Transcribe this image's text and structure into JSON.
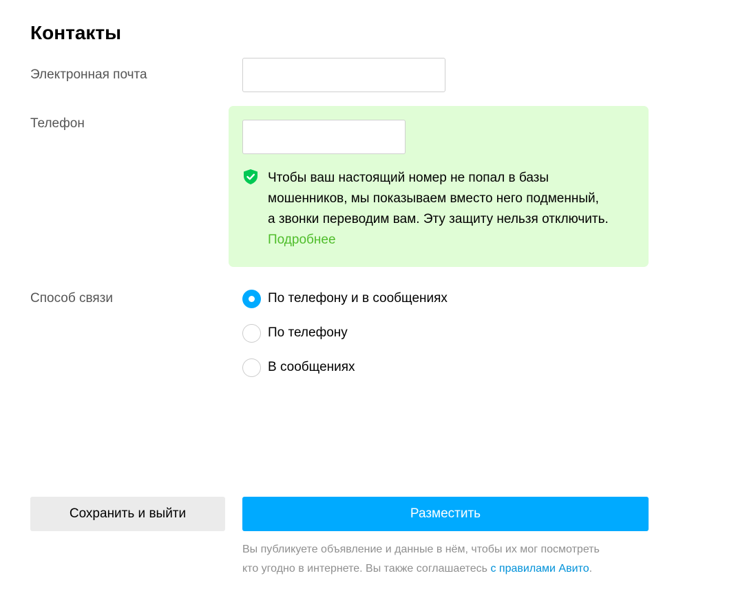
{
  "section": {
    "title": "Контакты"
  },
  "email": {
    "label": "Электронная почта",
    "value": ""
  },
  "phone": {
    "label": "Телефон",
    "value": "",
    "notice_line1": "Чтобы ваш настоящий номер не попал в базы",
    "notice_line2": "мошенников, мы показываем вместо него подменный,",
    "notice_line3": "а звонки переводим вам. Эту защиту нельзя отключить.",
    "notice_link": "Подробнее",
    "notice_icon": "shield-check-icon"
  },
  "contact_method": {
    "label": "Способ связи",
    "options": [
      {
        "label": "По телефону и в сообщениях",
        "selected": true
      },
      {
        "label": "По телефону",
        "selected": false
      },
      {
        "label": "В сообщениях",
        "selected": false
      }
    ]
  },
  "actions": {
    "save_label": "Сохранить и выйти",
    "publish_label": "Разместить"
  },
  "disclaimer": {
    "text_line1": "Вы публикуете объявление и данные в нём, чтобы их мог посмотреть",
    "text_line2": "кто угодно в интернете. Вы также соглашаетесь ",
    "link": "с правилами Авито",
    "suffix": "."
  },
  "colors": {
    "accent": "#00aaff",
    "notice_bg": "#e0fdd6",
    "notice_link": "#4fbd2b",
    "shield": "#00c853"
  }
}
